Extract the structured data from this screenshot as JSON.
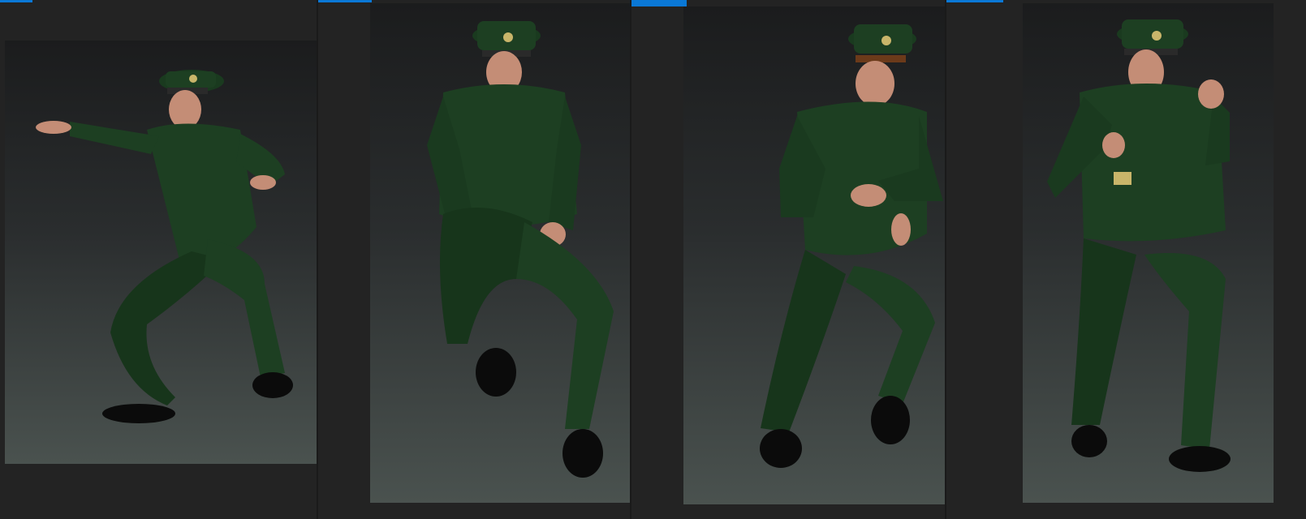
{
  "colors": {
    "accent": "#0a78d6",
    "background": "#1e1e1e",
    "uniform": "#1d3f22",
    "uniform_shadow": "#0f2613",
    "shirt": "#e9e5c9",
    "tie": "#1a1a1a",
    "skin": "#c48d76",
    "shoe": "#0b0b0b",
    "badge": "#c9b56a"
  },
  "thumbnails": [
    {
      "pose": "fighting-stance-reach",
      "selected": true
    },
    {
      "pose": "seated-knee-raise",
      "selected": true
    },
    {
      "pose": "walking-crouch",
      "selected": true
    },
    {
      "pose": "boxing-guard",
      "selected": true
    }
  ]
}
